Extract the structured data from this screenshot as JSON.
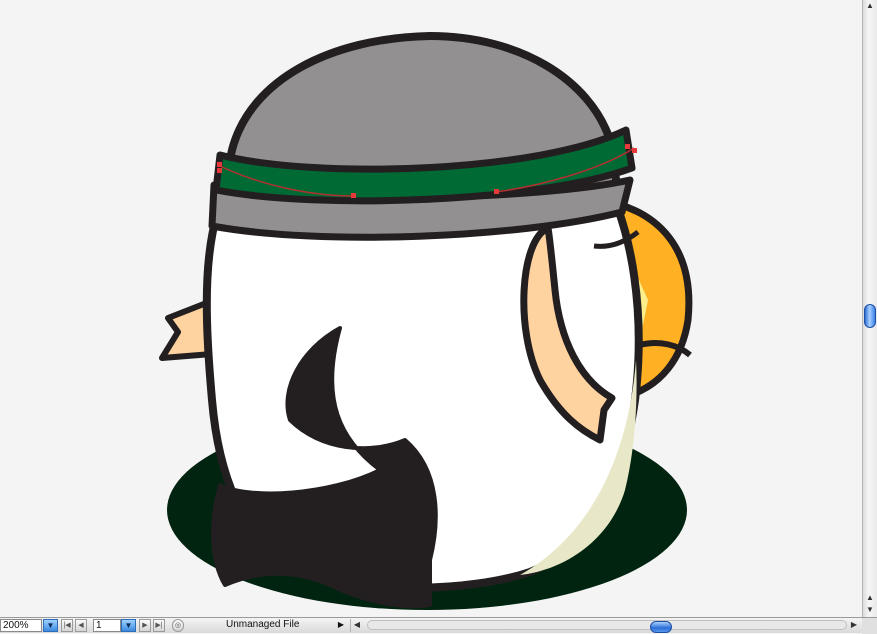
{
  "window": {
    "zoom_level": "200%",
    "page_number": "1",
    "status": "Unmanaged File"
  },
  "colors": {
    "canvas_bg": "#f4f4f4",
    "outline": "#231f20",
    "headband": "#006a35",
    "hat": "#929091",
    "shadow": "#00240f",
    "skin": "#ffd3a0",
    "beak": "#ffb023",
    "beak_highlight": "#fcee8a",
    "belly_shade": "#e8e8c8",
    "selection": "#e63a3a"
  },
  "icons": {
    "zoom_dropdown": "triangle-down-icon",
    "first_page": "first-page-icon",
    "prev_page": "prev-page-icon",
    "next_page": "next-page-icon",
    "last_page": "last-page-icon",
    "page_dropdown": "triangle-down-icon",
    "status_menu": "play-arrow-icon"
  }
}
